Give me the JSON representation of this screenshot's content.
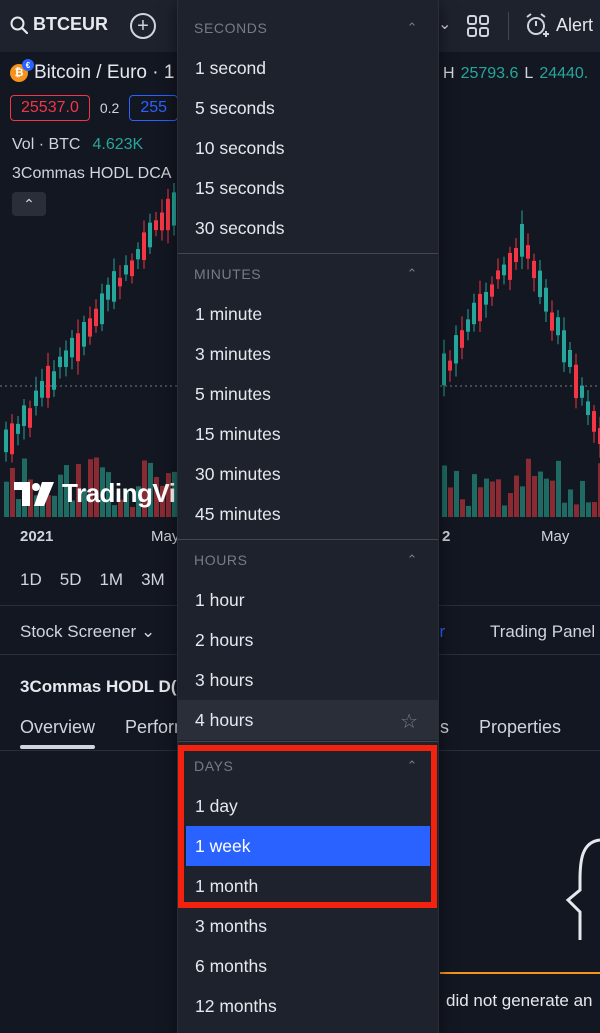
{
  "toolbar": {
    "symbol": "BTCEUR",
    "alert_label": "Alert"
  },
  "chart": {
    "title": "Bitcoin / Euro · 1",
    "high_label": "H",
    "high_value": "25793.6",
    "low_label": "L",
    "low_value": "24440.",
    "sell_price": "25537.0",
    "spread": "0.2",
    "buy_price": "255",
    "volume_label": "Vol · BTC",
    "volume_value": "4.623K",
    "indicator": "3Commas HODL DCA",
    "watermark": "TradingVi",
    "time_labels": [
      "2021",
      "May",
      "2",
      "May"
    ],
    "colors": {
      "up": "#26a69a",
      "down": "#f23645",
      "accent": "#2962ff"
    }
  },
  "ranges": [
    "1D",
    "5D",
    "1M",
    "3M",
    "("
  ],
  "bottom_panel": {
    "screener_label": "Stock Screener",
    "link_fragment": "er",
    "trading_panel_label": "Trading Panel",
    "strategy_title": "3Commas HODL D(",
    "tabs": [
      "Overview",
      "Perform",
      "s",
      "Properties"
    ],
    "warning_text": "did not generate an"
  },
  "dropdown": {
    "sections": [
      {
        "header": "SECONDS",
        "items": [
          "1 second",
          "5 seconds",
          "10 seconds",
          "15 seconds",
          "30 seconds"
        ]
      },
      {
        "header": "MINUTES",
        "items": [
          "1 minute",
          "3 minutes",
          "5 minutes",
          "15 minutes",
          "30 minutes",
          "45 minutes"
        ]
      },
      {
        "header": "HOURS",
        "items": [
          "1 hour",
          "2 hours",
          "3 hours",
          "4 hours"
        ]
      },
      {
        "header": "DAYS",
        "items": [
          "1 day",
          "1 week",
          "1 month",
          "3 months",
          "6 months",
          "12 months"
        ]
      }
    ],
    "selected": "1 week"
  }
}
